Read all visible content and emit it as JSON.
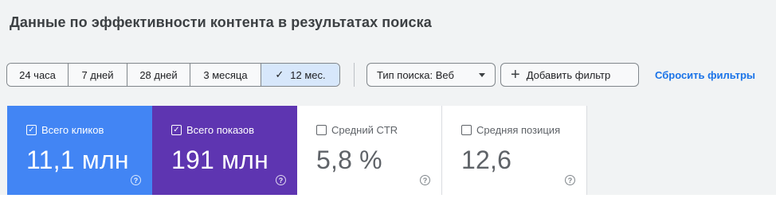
{
  "header": {
    "title": "Данные по эффективности контента в результатах поиска"
  },
  "date_range": {
    "options": [
      "24 часа",
      "7 дней",
      "28 дней",
      "3 месяца",
      "12 мес."
    ],
    "selected_index": 4
  },
  "filters": {
    "search_type_label": "Тип поиска: Веб",
    "add_filter_label": "Добавить фильтр",
    "reset_label": "Сбросить фильтры"
  },
  "metrics": [
    {
      "label": "Всего кликов",
      "value": "11,1 млн",
      "checked": true,
      "color": "#4285f4"
    },
    {
      "label": "Всего показов",
      "value": "191 млн",
      "checked": true,
      "color": "#5e35b1"
    },
    {
      "label": "Средний CTR",
      "value": "5,8 %",
      "checked": false,
      "color": "#ffffff"
    },
    {
      "label": "Средняя позиция",
      "value": "12,6",
      "checked": false,
      "color": "#ffffff"
    }
  ]
}
